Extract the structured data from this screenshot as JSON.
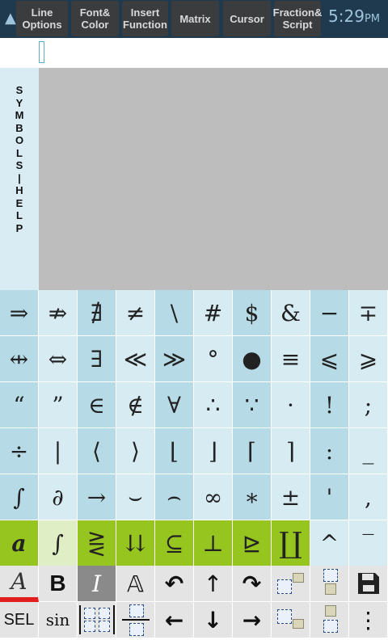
{
  "status": {
    "time": "5:29",
    "ampm": "PM"
  },
  "toolbar": [
    {
      "label": "Line\nOptions",
      "name": "line-options-button"
    },
    {
      "label": "Font&\nColor",
      "name": "font-color-button"
    },
    {
      "label": "Insert\nFunction",
      "name": "insert-function-button"
    },
    {
      "label": "Matrix",
      "name": "matrix-button"
    },
    {
      "label": "Cursor",
      "name": "cursor-button"
    },
    {
      "label": "Fraction&\nScript",
      "name": "fraction-script-button"
    }
  ],
  "help_strip": {
    "label": "S\nY\nM\nB\nO\nL\nS\n|\nH\nE\nL\nP"
  },
  "symbols": [
    [
      "⇒",
      "⇏",
      "∄",
      "≠",
      "\\",
      "#",
      "$",
      "&",
      "−",
      "∓"
    ],
    [
      "⇹",
      "⇔",
      "∃",
      "≪",
      "≫",
      "°",
      "●",
      "≡",
      "⩽",
      "⩾"
    ],
    [
      "“",
      "”",
      "∈",
      "∉",
      "∀",
      "∴",
      "∵",
      "·",
      "!",
      ";"
    ],
    [
      "÷",
      "|",
      "⟨",
      "⟩",
      "⌊",
      "⌋",
      "⌈",
      "⌉",
      ":",
      "_"
    ],
    [
      "∫",
      "∂",
      "→",
      "⌣",
      "⌢",
      "∞",
      "∗",
      "±",
      "'",
      ","
    ],
    [
      "𝒂",
      "∫",
      "⋛",
      "⇊",
      "⊆",
      "⊥",
      "⊵",
      "∐",
      "^",
      "‾"
    ]
  ],
  "bottom_tools": {
    "row1": [
      "A",
      "B",
      "I",
      "𝔸",
      "↶",
      "↑",
      "↷",
      "",
      "",
      ""
    ],
    "row2": [
      "SEL",
      "sin",
      "",
      "",
      "←",
      "↓",
      "→",
      "",
      "",
      "⋮"
    ]
  }
}
